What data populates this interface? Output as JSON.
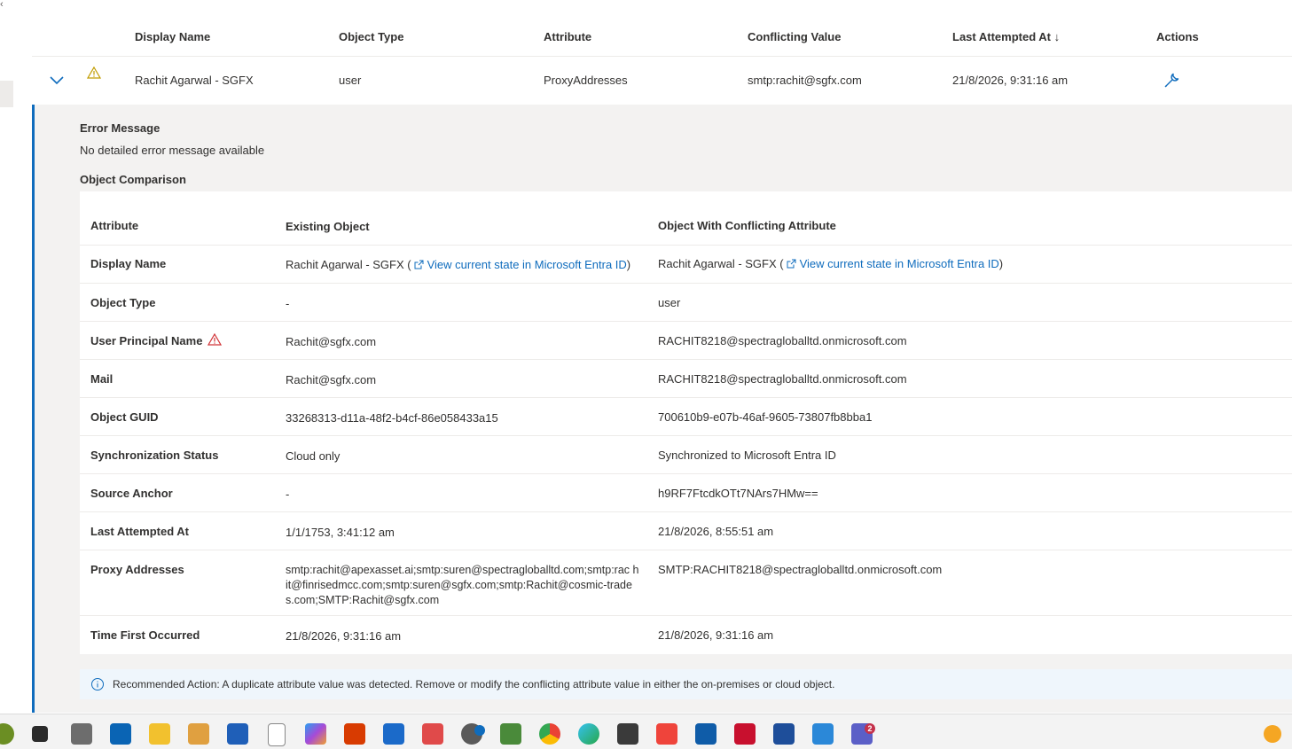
{
  "header": {
    "display_name": "Display Name",
    "object_type": "Object Type",
    "attribute": "Attribute",
    "conflicting_value": "Conflicting Value",
    "last_attempted_at": "Last Attempted At ↓",
    "actions": "Actions"
  },
  "row": {
    "display_name": "Rachit Agarwal - SGFX",
    "object_type": "user",
    "attribute": "ProxyAddresses",
    "conflicting_value": "smtp:rachit@sgfx.com",
    "last_attempted_at": "21/8/2026, 9:31:16 am",
    "expand_icon": "chevron-down-icon",
    "status_icon": "warning-icon",
    "action_icon": "wrench-icon"
  },
  "details": {
    "error_title": "Error Message",
    "error_message": "No detailed error message available",
    "comparison_title": "Object Comparison",
    "columns": {
      "attribute": "Attribute",
      "existing": "Existing Object",
      "conflicting": "Object With Conflicting Attribute"
    },
    "rows": [
      {
        "attr": "Display Name",
        "existing": "Rachit Agarwal - SGFX (",
        "existing_link": "View current state in Microsoft Entra ID",
        "existing_close": ")",
        "conflicting": "Rachit Agarwal - SGFX (",
        "conflicting_link": "View current state in Microsoft Entra ID",
        "conflicting_close": ")"
      },
      {
        "attr": "Object Type",
        "existing": "-",
        "conflicting": "user"
      },
      {
        "attr": "User Principal Name",
        "existing": "Rachit@sgfx.com",
        "conflicting": "RACHIT8218@spectragloballtd.onmicrosoft.com"
      },
      {
        "attr": "Mail",
        "existing": "Rachit@sgfx.com",
        "conflicting": "RACHIT8218@spectragloballtd.onmicrosoft.com"
      },
      {
        "attr": "Object GUID",
        "existing": "33268313-d11a-48f2-b4cf-86e058433a15",
        "conflicting": "700610b9-e07b-46af-9605-73807fb8bba1"
      },
      {
        "attr": "Synchronization Status",
        "existing": "Cloud only",
        "conflicting": "Synchronized to Microsoft Entra ID"
      },
      {
        "attr": "Source Anchor",
        "existing": "-",
        "conflicting": "h9RF7FtcdkOTt7NArs7HMw=="
      },
      {
        "attr": "Last Attempted At",
        "existing": "1/1/1753, 3:41:12 am",
        "conflicting": "21/8/2026, 8:55:51 am"
      },
      {
        "attr": "Proxy Addresses",
        "existing": "smtp:rachit@apexasset.ai;smtp:suren@spectragloballtd.com;smtp:rac hit@finrisedmcc.com;smtp:suren@sgfx.com;smtp:Rachit@cosmic-trades.com;SMTP:Rachit@sgfx.com",
        "conflicting": "SMTP:RACHIT8218@spectragloballtd.onmicrosoft.com"
      },
      {
        "attr": "Time First Occurred",
        "existing": "21/8/2026, 9:31:16 am",
        "conflicting": "21/8/2026, 9:31:16 am"
      }
    ],
    "recommended_action": "Recommended Action: A duplicate attribute value was detected. Remove or modify the conflicting attribute value in either the on-premises or cloud object."
  },
  "taskbar": {
    "apps": [
      "start-icon",
      "task-view-icon",
      "scanner-icon",
      "outlook-classic-icon",
      "file-explorer-icon",
      "paint-icon",
      "whiteboard-icon",
      "notepad-icon",
      "m365-copilot-icon",
      "office-icon",
      "store-icon",
      "snipping-tool-icon",
      "clock-icon",
      "charts-icon",
      "chrome-icon",
      "edge-icon",
      "network-icon",
      "anydesk-icon",
      "outlook-icon",
      "acrobat-icon",
      "notes-icon",
      "remote-desktop-icon",
      "teams-icon"
    ],
    "teams_badge": "2",
    "accent_color": "#0f6cbd",
    "warning_color": "#d13438"
  }
}
